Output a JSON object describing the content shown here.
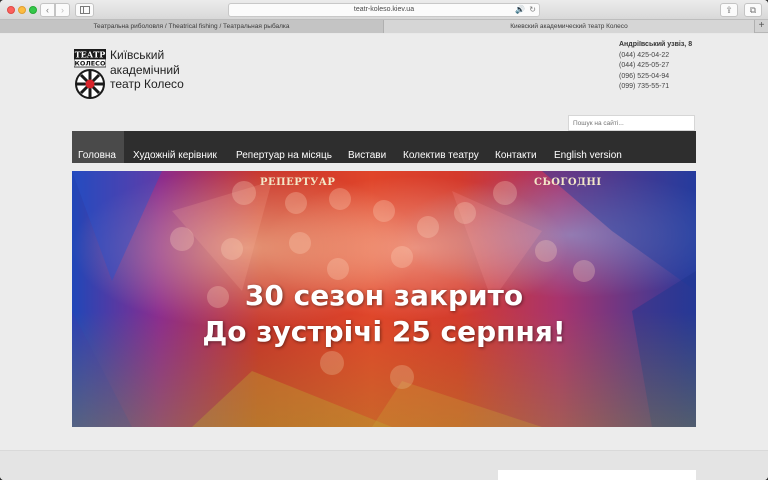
{
  "browser": {
    "address": "teatr-koleso.kiev.ua",
    "tabs": [
      {
        "label": "Театральна риболовля / Theatrical fishing / Театральная рыбалка"
      },
      {
        "label": "Киевский академический театр Колесо"
      }
    ]
  },
  "header": {
    "logo_text": [
      "ТЕАТР",
      "КОЛЕСО"
    ],
    "title_lines": [
      "Київський",
      "академічний",
      "театр Колесо"
    ]
  },
  "contacts": {
    "address": "Андріївський узвіз, 8",
    "phones": [
      "(044) 425-04-22",
      "(044) 425-05-27",
      "(096) 525-04-94",
      "(099) 735-55-71"
    ]
  },
  "search": {
    "placeholder": "Пошук на сайті..."
  },
  "nav": {
    "items": [
      {
        "label": "Головна"
      },
      {
        "label": "Художній керівник"
      },
      {
        "label": "Репертуар на місяць"
      },
      {
        "label": "Вистави"
      },
      {
        "label": "Колектив театру"
      },
      {
        "label": "Контакти"
      },
      {
        "label": "English version"
      }
    ]
  },
  "banner": {
    "line1": "30 сезон закрито",
    "line2": "До зустрічі 25 серпня!",
    "sign_left": "РЕПЕРТУАР",
    "sign_right": "СЬОГОДНІ"
  }
}
